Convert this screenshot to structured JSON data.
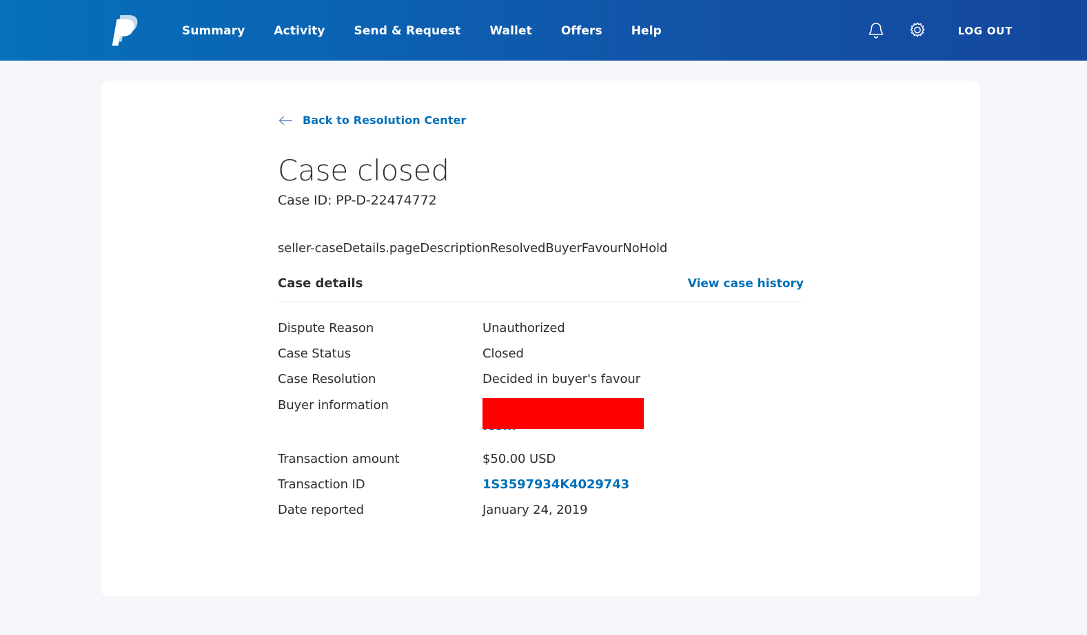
{
  "header": {
    "logo_name": "paypal-logo",
    "nav": [
      {
        "label": "Summary"
      },
      {
        "label": "Activity"
      },
      {
        "label": "Send & Request"
      },
      {
        "label": "Wallet"
      },
      {
        "label": "Offers"
      },
      {
        "label": "Help"
      }
    ],
    "notifications_icon": "bell-icon",
    "settings_icon": "gear-icon",
    "logout_label": "LOG OUT",
    "gradient_start": "#0670ba",
    "gradient_end": "#14479e"
  },
  "page": {
    "back_link": "Back to Resolution Center",
    "back_icon": "arrow-left-icon",
    "title": "Case closed",
    "case_id": "Case ID: PP-D-22474772",
    "description": "seller-caseDetails.pageDescriptionResolvedBuyerFavourNoHold",
    "section_title": "Case details",
    "history_link": "View case history",
    "link_color": "#0070ba",
    "redaction_color": "#fe0000"
  },
  "details": [
    {
      "label": "Dispute Reason",
      "value": "Unauthorized",
      "type": "text"
    },
    {
      "label": "Case Status",
      "value": "Closed",
      "type": "text"
    },
    {
      "label": "Case Resolution",
      "value": "Decided in buyer's favour",
      "type": "text"
    },
    {
      "label": "Buyer information",
      "value": ".com",
      "type": "redacted-email"
    },
    {
      "label": "Transaction amount",
      "value": "$50.00 USD",
      "type": "text"
    },
    {
      "label": "Transaction ID",
      "value": "1S3597934K4029743",
      "type": "link"
    },
    {
      "label": "Date reported",
      "value": "January 24, 2019",
      "type": "text"
    }
  ]
}
